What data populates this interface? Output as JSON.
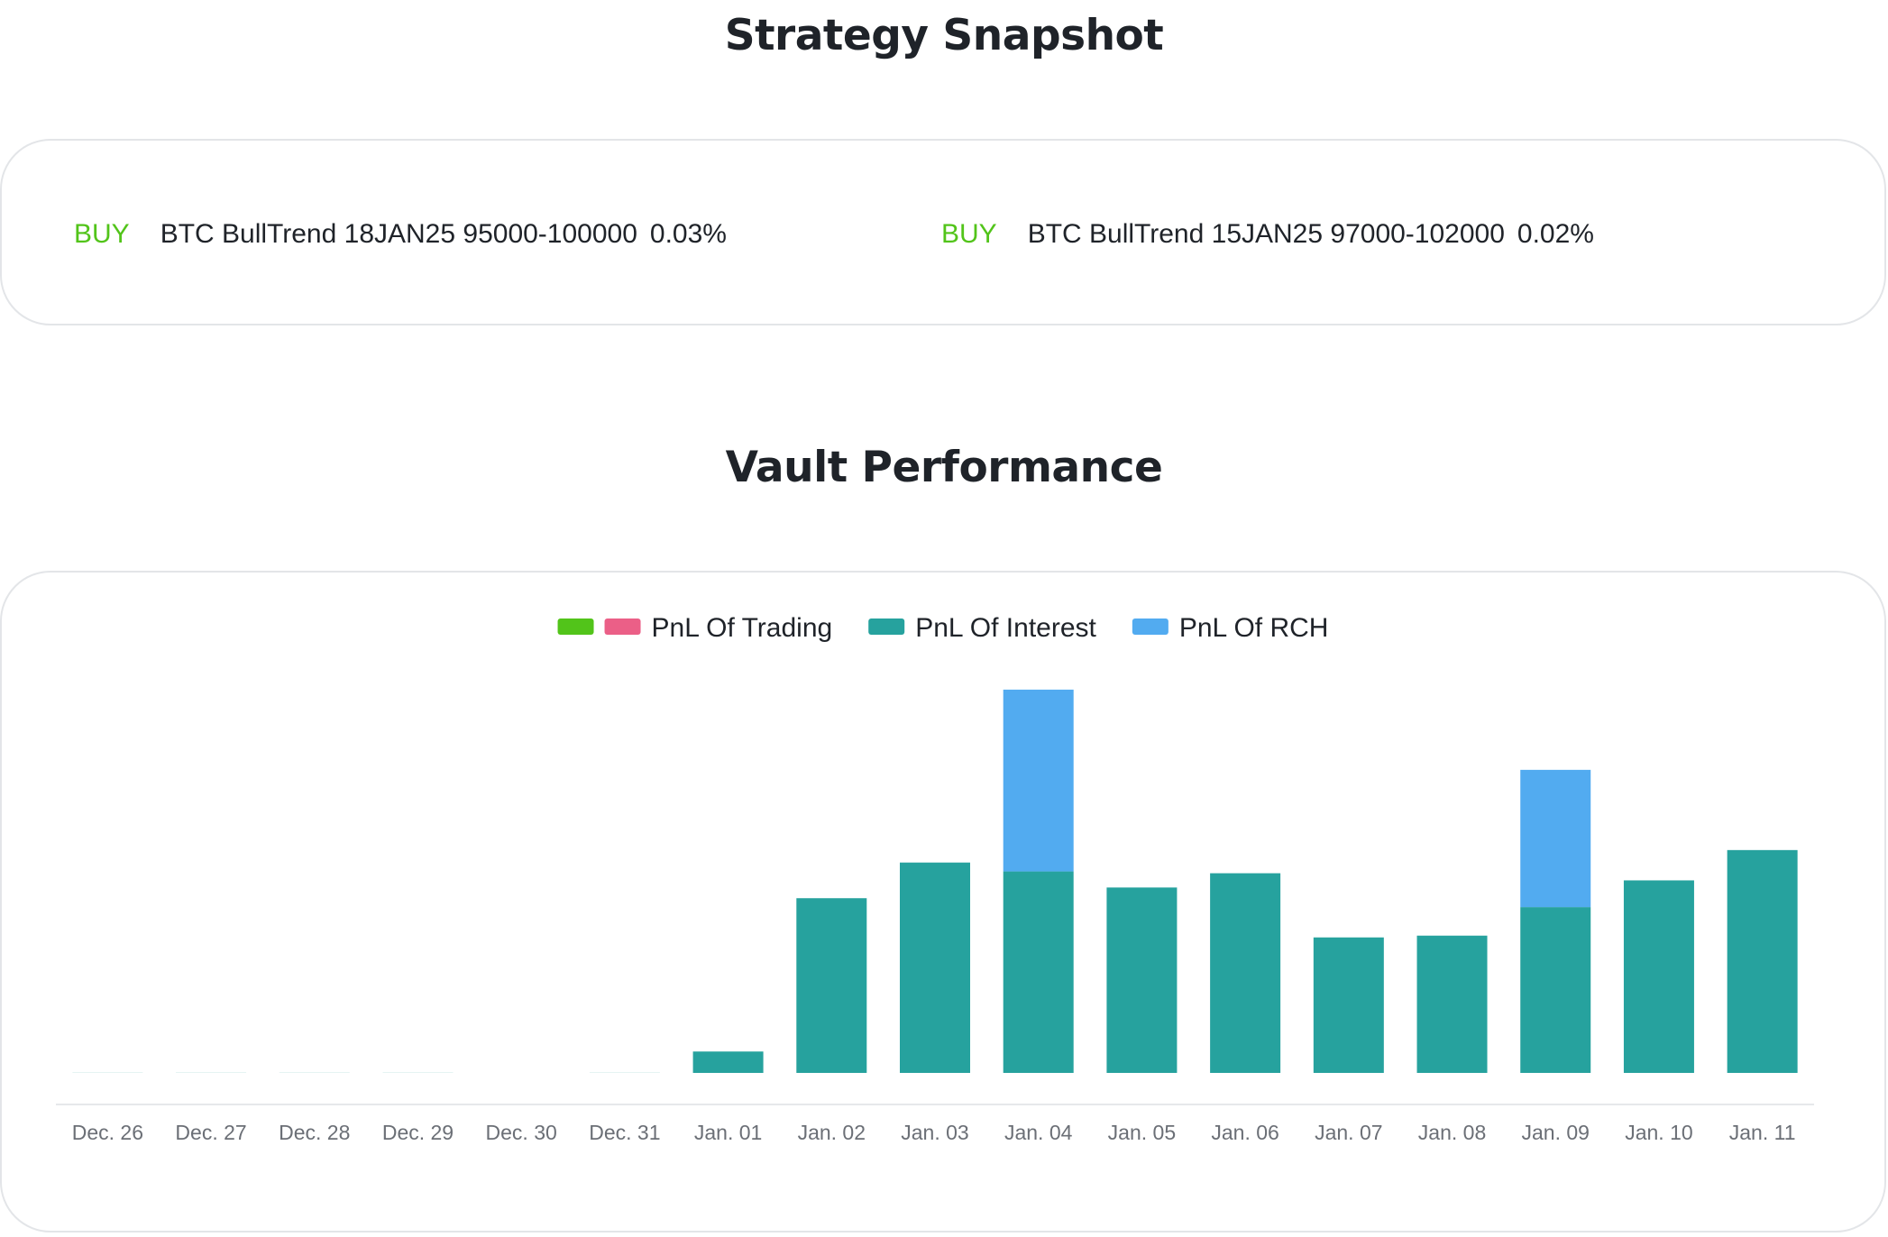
{
  "strategy_snapshot": {
    "title": "Strategy Snapshot",
    "positions": [
      {
        "side": "BUY",
        "name": "BTC BullTrend 18JAN25 95000-100000",
        "percent": "0.03%"
      },
      {
        "side": "BUY",
        "name": "BTC BullTrend 15JAN25 97000-102000",
        "percent": "0.02%"
      }
    ]
  },
  "vault_performance": {
    "title": "Vault Performance"
  },
  "colors": {
    "buy": "#52c41a",
    "trading_positive": "#52c41a",
    "trading_negative": "#eb5f87",
    "interest": "#26a29e",
    "rch": "#52abf0",
    "axis": "#e6e8eb"
  },
  "chart_data": {
    "type": "bar",
    "stacked": true,
    "legend_position": "top-center",
    "grid": false,
    "y_axis_visible": false,
    "ylim": [
      0,
      1.1
    ],
    "categories": [
      "Dec. 26",
      "Dec. 27",
      "Dec. 28",
      "Dec. 29",
      "Dec. 30",
      "Dec. 31",
      "Jan. 01",
      "Jan. 02",
      "Jan. 03",
      "Jan. 04",
      "Jan. 05",
      "Jan. 06",
      "Jan. 07",
      "Jan. 08",
      "Jan. 09",
      "Jan. 10",
      "Jan. 11"
    ],
    "legend": [
      {
        "label": "PnL Of Trading",
        "swatches": [
          "#52c41a",
          "#eb5f87"
        ]
      },
      {
        "label": "PnL Of Interest",
        "swatches": [
          "#26a29e"
        ]
      },
      {
        "label": "PnL Of RCH",
        "swatches": [
          "#52abf0"
        ]
      }
    ],
    "series": [
      {
        "name": "PnL Of Trading",
        "values": [
          0,
          0,
          0,
          0,
          0,
          0,
          0,
          0,
          0,
          0,
          0,
          0,
          0,
          0,
          0,
          0,
          0
        ]
      },
      {
        "name": "PnL Of Interest",
        "values": [
          0.002,
          0.002,
          0.002,
          0.002,
          0,
          0.002,
          0.06,
          0.49,
          0.59,
          0.565,
          0.52,
          0.56,
          0.38,
          0.385,
          0.465,
          0.54,
          0.625
        ]
      },
      {
        "name": "PnL Of RCH",
        "values": [
          0,
          0,
          0,
          0,
          0,
          0,
          0,
          0,
          0,
          0.51,
          0,
          0,
          0,
          0,
          0.385,
          0,
          0
        ]
      }
    ]
  }
}
